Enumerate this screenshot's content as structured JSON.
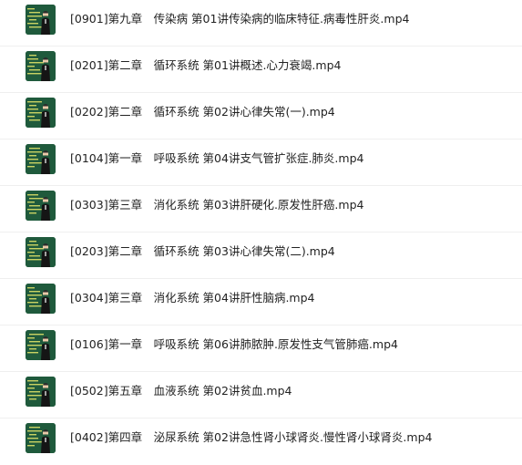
{
  "files": [
    {
      "name": "[0901]第九章　传染病 第01讲传染病的临床特征.病毒性肝炎.mp4",
      "thumbnail": "video-thumbnail"
    },
    {
      "name": "[0201]第二章　循环系统 第01讲概述.心力衰竭.mp4",
      "thumbnail": "video-thumbnail"
    },
    {
      "name": "[0202]第二章　循环系统 第02讲心律失常(一).mp4",
      "thumbnail": "video-thumbnail"
    },
    {
      "name": "[0104]第一章　呼吸系统 第04讲支气管扩张症.肺炎.mp4",
      "thumbnail": "video-thumbnail"
    },
    {
      "name": "[0303]第三章　消化系统 第03讲肝硬化.原发性肝癌.mp4",
      "thumbnail": "video-thumbnail"
    },
    {
      "name": "[0203]第二章　循环系统 第03讲心律失常(二).mp4",
      "thumbnail": "video-thumbnail"
    },
    {
      "name": "[0304]第三章　消化系统 第04讲肝性脑病.mp4",
      "thumbnail": "video-thumbnail"
    },
    {
      "name": "[0106]第一章　呼吸系统 第06讲肺脓肿.原发性支气管肺癌.mp4",
      "thumbnail": "video-thumbnail"
    },
    {
      "name": "[0502]第五章　血液系统 第02讲贫血.mp4",
      "thumbnail": "video-thumbnail"
    },
    {
      "name": "[0402]第四章　泌尿系统 第02讲急性肾小球肾炎.慢性肾小球肾炎.mp4",
      "thumbnail": "video-thumbnail"
    }
  ],
  "colors": {
    "board": "#1f5a3c",
    "chalk": "#e8e86a",
    "text": "#222222",
    "divider": "#efefef"
  }
}
